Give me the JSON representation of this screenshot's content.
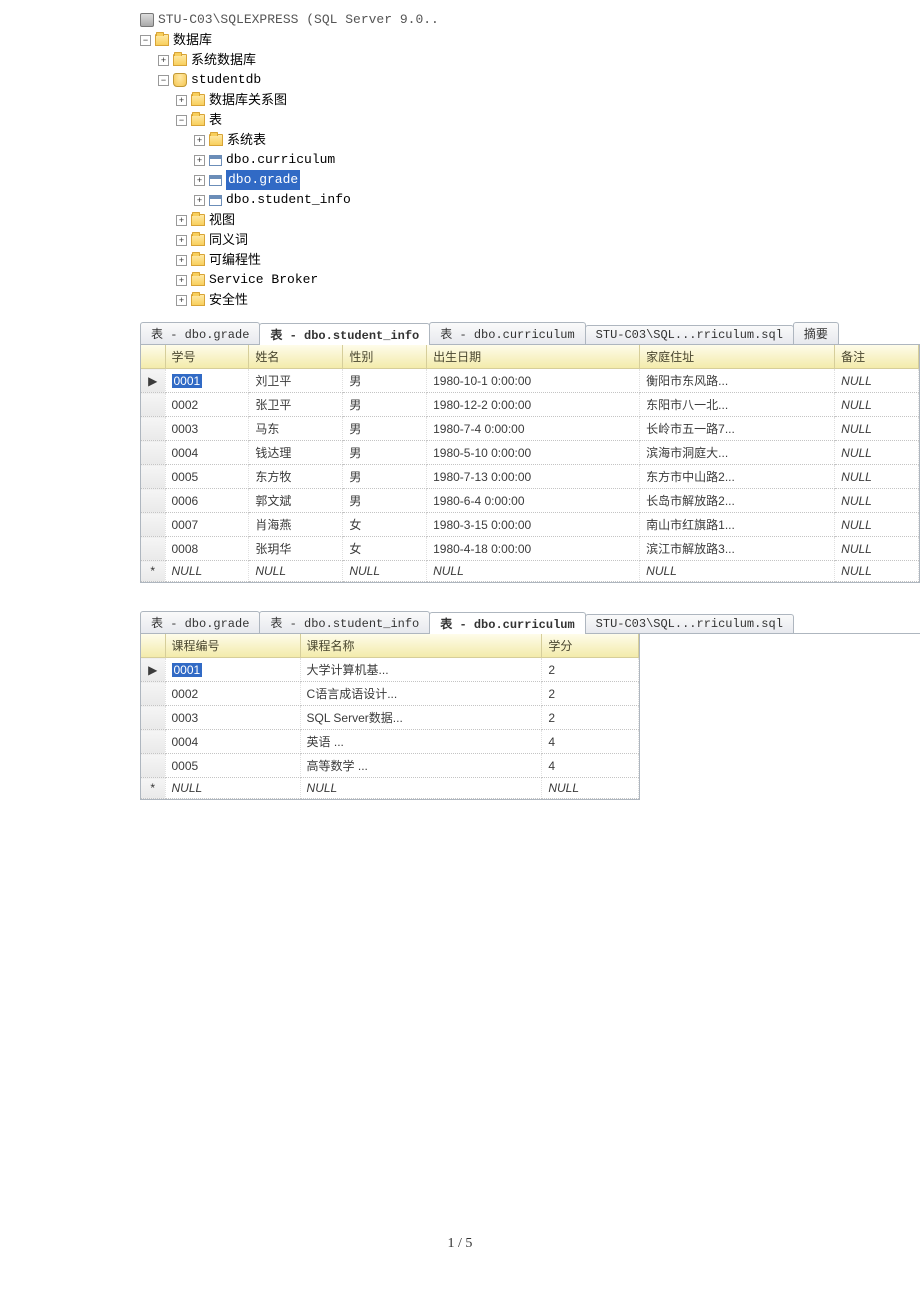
{
  "tree": {
    "server": "STU-C03\\SQLEXPRESS (SQL Server 9.0..",
    "databases": "数据库",
    "sys_db": "系统数据库",
    "user_db": "studentdb",
    "db_diagram": "数据库关系图",
    "tables": "表",
    "sys_tables": "系统表",
    "tbl_curriculum": "dbo.curriculum",
    "tbl_grade": "dbo.grade",
    "tbl_student_info": "dbo.student_info",
    "views": "视图",
    "synonyms": "同义词",
    "programmability": "可编程性",
    "service_broker": "Service Broker",
    "security": "安全性"
  },
  "tabs1": {
    "t1": "表 - dbo.grade",
    "t2": "表 - dbo.student_info",
    "t3": "表 - dbo.curriculum",
    "t4": "STU-C03\\SQL...rriculum.sql",
    "t5": "摘要"
  },
  "grid1": {
    "headers": {
      "c1": "学号",
      "c2": "姓名",
      "c3": "性别",
      "c4": "出生日期",
      "c5": "家庭住址",
      "c6": "备注"
    },
    "rows": [
      {
        "marker": "▶",
        "c1": "0001",
        "c1_sel": true,
        "c2": "刘卫平",
        "c3": "男",
        "c4": "1980-10-1 0:00:00",
        "c5": "衡阳市东风路...",
        "c6": "NULL",
        "c6_null": true
      },
      {
        "marker": "",
        "c1": "0002",
        "c2": "张卫平",
        "c3": "男",
        "c4": "1980-12-2 0:00:00",
        "c5": "东阳市八一北...",
        "c6": "NULL",
        "c6_null": true
      },
      {
        "marker": "",
        "c1": "0003",
        "c2": "马东",
        "c3": "男",
        "c4": "1980-7-4 0:00:00",
        "c5": "长岭市五一路7...",
        "c6": "NULL",
        "c6_null": true
      },
      {
        "marker": "",
        "c1": "0004",
        "c2": "钱达理",
        "c3": "男",
        "c4": "1980-5-10 0:00:00",
        "c5": "滨海市洞庭大...",
        "c6": "NULL",
        "c6_null": true
      },
      {
        "marker": "",
        "c1": "0005",
        "c2": "东方牧",
        "c3": "男",
        "c4": "1980-7-13 0:00:00",
        "c5": "东方市中山路2...",
        "c6": "NULL",
        "c6_null": true
      },
      {
        "marker": "",
        "c1": "0006",
        "c2": "郭文斌",
        "c3": "男",
        "c4": "1980-6-4 0:00:00",
        "c5": "长岛市解放路2...",
        "c6": "NULL",
        "c6_null": true
      },
      {
        "marker": "",
        "c1": "0007",
        "c2": "肖海燕",
        "c3": "女",
        "c4": "1980-3-15 0:00:00",
        "c5": "南山市红旗路1...",
        "c6": "NULL",
        "c6_null": true
      },
      {
        "marker": "",
        "c1": "0008",
        "c2": "张玥华",
        "c3": "女",
        "c4": "1980-4-18 0:00:00",
        "c5": "滨江市解放路3...",
        "c6": "NULL",
        "c6_null": true
      },
      {
        "marker": "*",
        "null_row": true,
        "c1": "NULL",
        "c2": "NULL",
        "c3": "NULL",
        "c4": "NULL",
        "c5": "NULL",
        "c6": "NULL"
      }
    ]
  },
  "tabs2": {
    "t1": "表 - dbo.grade",
    "t2": "表 - dbo.student_info",
    "t3": "表 - dbo.curriculum",
    "t4": "STU-C03\\SQL...rriculum.sql"
  },
  "grid2": {
    "headers": {
      "c1": "课程编号",
      "c2": "课程名称",
      "c3": "学分"
    },
    "rows": [
      {
        "marker": "▶",
        "c1": "0001",
        "c1_sel": true,
        "c2": "大学计算机基...",
        "c3": "2"
      },
      {
        "marker": "",
        "c1": "0002",
        "c2": "C语言成语设计...",
        "c3": "2"
      },
      {
        "marker": "",
        "c1": "0003",
        "c2": "SQL Server数据...",
        "c3": "2"
      },
      {
        "marker": "",
        "c1": "0004",
        "c2": "英语        ...",
        "c3": "4"
      },
      {
        "marker": "",
        "c1": "0005",
        "c2": "高等数学    ...",
        "c3": "4"
      },
      {
        "marker": "*",
        "null_row": true,
        "c1": "NULL",
        "c2": "NULL",
        "c3": "NULL"
      }
    ]
  },
  "page_num": "1  /  5"
}
